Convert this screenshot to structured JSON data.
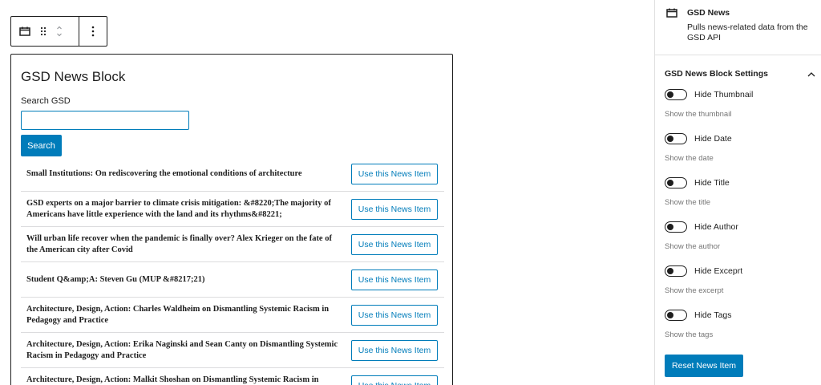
{
  "toolbar": {
    "icons": [
      "calendar-icon",
      "drag-handle-icon",
      "move-up-down-icon",
      "more-options-icon"
    ]
  },
  "block": {
    "title": "GSD News Block",
    "search_label": "Search GSD",
    "search_value": "",
    "search_button": "Search",
    "use_button_label": "Use this News Item",
    "news_items": [
      "Small Institutions: On rediscovering the emotional conditions of architecture",
      "GSD experts on a major barrier to climate crisis mitigation: &#8220;The majority of Americans have little experience with the land and its rhythms&#8221;",
      "Will urban life recover when the pandemic is finally over? Alex Krieger on the fate of the American city after Covid",
      "Student Q&amp;A: Steven Gu (MUP &#8217;21)",
      "Architecture, Design, Action: Charles Waldheim on Dismantling Systemic Racism in Pedagogy and Practice",
      "Architecture, Design, Action: Erika Naginski and Sean Canty on Dismantling Systemic Racism in Pedagogy and Practice",
      "Architecture, Design, Action: Malkit Shoshan on Dismantling Systemic Racism in Pedagogy and Practice"
    ]
  },
  "sidebar": {
    "block_name": "GSD News",
    "block_description": "Pulls news-related data from the GSD API",
    "panel_title": "GSD News Block Settings",
    "settings": [
      {
        "label": "Hide Thumbnail",
        "help": "Show the thumbnail"
      },
      {
        "label": "Hide Date",
        "help": "Show the date"
      },
      {
        "label": "Hide Title",
        "help": "Show the title"
      },
      {
        "label": "Hide Author",
        "help": "Show the author"
      },
      {
        "label": "Hide Exceprt",
        "help": "Show the excerpt"
      },
      {
        "label": "Hide Tags",
        "help": "Show the tags"
      }
    ],
    "reset_button": "Reset News Item"
  },
  "colors": {
    "accent": "#007cba",
    "text": "#1e1e1e",
    "muted": "#757575",
    "border": "#dcdcde"
  }
}
